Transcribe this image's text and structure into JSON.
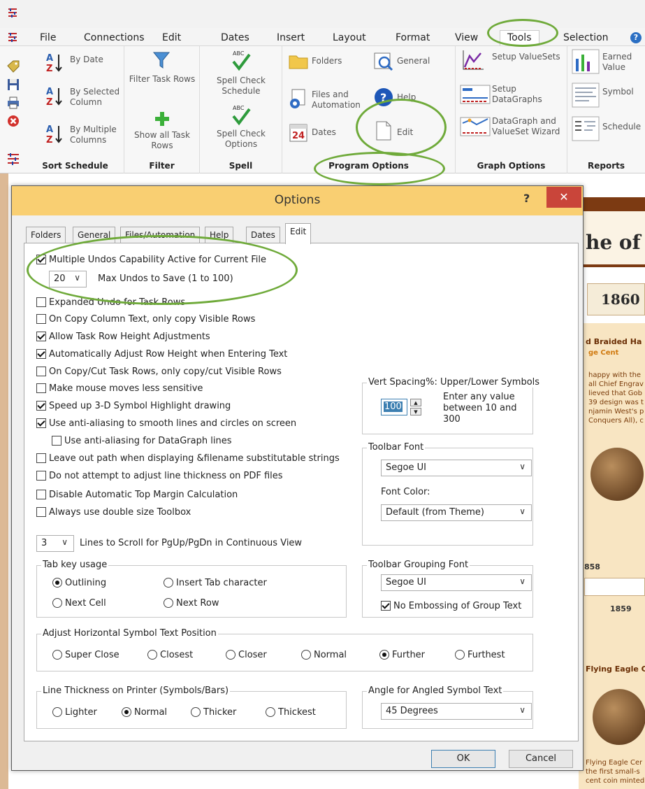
{
  "menu": {
    "items": [
      "File",
      "Connections",
      "Edit",
      "Dates",
      "Insert",
      "Layout",
      "Format",
      "View",
      "Tools",
      "Selection"
    ],
    "active": "Tools",
    "help_glyph": "?"
  },
  "ribbon": {
    "sort": {
      "by_date": "By Date",
      "by_selected_column": "By Selected Column",
      "by_multiple_columns": "By Multiple Columns",
      "label": "Sort Schedule"
    },
    "filter": {
      "filter_task_rows": "Filter Task Rows",
      "show_all_task_rows": "Show all Task Rows",
      "label": "Filter"
    },
    "spell": {
      "spell_check_schedule": "Spell Check Schedule",
      "spell_check_options": "Spell Check Options",
      "label": "Spell"
    },
    "program_options": {
      "folders": "Folders",
      "files_and_automation": "Files and Automation",
      "dates": "Dates",
      "general": "General",
      "help": "Help",
      "edit": "Edit",
      "label": "Program Options"
    },
    "graph_options": {
      "setup_valuesets": "Setup ValueSets",
      "setup_datagraphs": "Setup DataGraphs",
      "wizard": "DataGraph and ValueSet Wizard",
      "label": "Graph Options"
    },
    "reports": {
      "earned_value": "Earned Value",
      "symbol": "Symbol",
      "schedule": "Schedule",
      "label": "Reports"
    }
  },
  "document": {
    "title_fragment": "he of",
    "year_1860": "1860",
    "braided_heading": "d Braided Ha",
    "braided_sub": "ge Cent",
    "paragraph_lines": [
      "happy with the",
      "all Chief Engrav",
      "lieved that Gob",
      "39 design was t",
      "njamin West's p",
      "Conquers All), c"
    ],
    "year_1858": "858",
    "year_1859": "1859",
    "flying_eagle_heading": "Flying Eagle C",
    "footer_lines": [
      "Flying Eagle Cer",
      "the first small-s",
      "cent coin minted in"
    ]
  },
  "dialog": {
    "title": "Options",
    "help_glyph": "?",
    "close_glyph": "✕",
    "tabs": [
      "Folders",
      "General",
      "Files/Automation",
      "Help",
      "Dates",
      "Edit"
    ],
    "active_tab": "Edit",
    "checkboxes": [
      {
        "label": "Multiple Undos Capability Active for Current File",
        "checked": true
      },
      {
        "label": "Expanded Undo for Task Rows",
        "checked": false
      },
      {
        "label": "On Copy Column Text, only copy Visible Rows",
        "checked": false
      },
      {
        "label": "Allow Task Row Height Adjustments",
        "checked": true
      },
      {
        "label": "Automatically Adjust Row Height when Entering Text",
        "checked": true
      },
      {
        "label": "On Copy/Cut Task Rows, only copy/cut Visible Rows",
        "checked": false
      },
      {
        "label": "Make mouse moves less sensitive",
        "checked": false
      },
      {
        "label": "Speed up 3-D Symbol Highlight drawing",
        "checked": true
      },
      {
        "label": "Use anti-aliasing to smooth lines and circles on screen",
        "checked": true
      },
      {
        "label": "Use anti-aliasing for DataGraph lines",
        "checked": false
      },
      {
        "label": "Leave out path when displaying &filename substitutable strings",
        "checked": false
      },
      {
        "label": "Do not attempt to adjust line thickness on PDF files",
        "checked": false
      },
      {
        "label": "Disable Automatic Top Margin Calculation",
        "checked": false
      },
      {
        "label": "Always use double size Toolbox",
        "checked": false
      }
    ],
    "max_undos": {
      "value": "20",
      "label": "Max Undos to Save (1 to 100)"
    },
    "lines_to_scroll": {
      "value": "3",
      "label": "Lines to Scroll for PgUp/PgDn in Continuous View"
    },
    "vert_spacing": {
      "title": "Vert Spacing%: Upper/Lower Symbols",
      "value": "100",
      "hint": "Enter any value between 10 and 300"
    },
    "toolbar_font": {
      "title": "Toolbar Font",
      "font": "Segoe UI",
      "color_label": "Font Color:",
      "color": "Default (from Theme)"
    },
    "tab_key": {
      "title": "Tab key usage",
      "options": [
        "Outlining",
        "Insert Tab character",
        "Next Cell",
        "Next Row"
      ],
      "selected": "Outlining"
    },
    "grouping_font": {
      "title": "Toolbar Grouping Font",
      "font": "Segoe UI",
      "no_embossing_label": "No Embossing of Group Text",
      "no_embossing": true
    },
    "symbol_text_position": {
      "title": "Adjust Horizontal Symbol Text Position",
      "options": [
        "Super Close",
        "Closest",
        "Closer",
        "Normal",
        "Further",
        "Furthest"
      ],
      "selected": "Further"
    },
    "line_thickness": {
      "title": "Line Thickness on Printer (Symbols/Bars)",
      "options": [
        "Lighter",
        "Normal",
        "Thicker",
        "Thickest"
      ],
      "selected": "Normal"
    },
    "angle": {
      "title": "Angle for Angled Symbol Text",
      "value": "45 Degrees"
    },
    "ok_label": "OK",
    "cancel_label": "Cancel"
  },
  "colors": {
    "dialog_title_bar": "#f9cf72",
    "close_button": "#c9453a",
    "annotation_green": "#6faa3a",
    "ribbon_bg": "#f7f7f7"
  }
}
